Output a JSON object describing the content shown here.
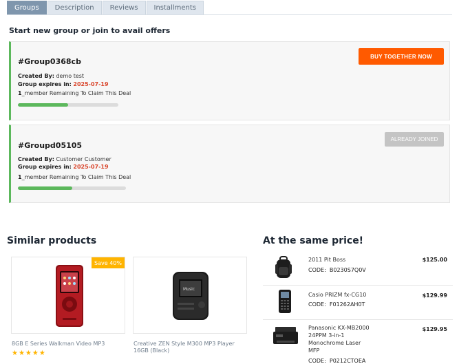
{
  "tabs": [
    {
      "label": "Groups",
      "active": true
    },
    {
      "label": "Description",
      "active": false
    },
    {
      "label": "Reviews",
      "active": false
    },
    {
      "label": "Installments",
      "active": false
    }
  ],
  "groups_section": {
    "title": "Start new group or join to avail offers",
    "groups": [
      {
        "name": "#Group0368cb",
        "created_by_label": "Created By:",
        "created_by": "demo test",
        "expires_label": "Group expires in:",
        "expires": "2025-07-19",
        "remaining_count": "1",
        "remaining_text": "_member Remaining To Claim This Deal",
        "progress": 0.5,
        "action_label": "BUY TOGETHER NOW"
      },
      {
        "name": "#Groupd05105",
        "created_by_label": "Created By:",
        "created_by": "Customer Customer",
        "expires_label": "Group expires in:",
        "expires": "2025-07-19",
        "remaining_count": "1",
        "remaining_text": "_member Remaining To Claim This Deal",
        "progress": 0.5,
        "action_label": "ALREADY JOINED"
      }
    ]
  },
  "similar": {
    "title": "Similar products",
    "products": [
      {
        "name": "8GB E Series Walkman Video MP3",
        "badge": "Save 40%",
        "stars": "★★★★★",
        "image": "red-walkman-icon"
      },
      {
        "name": "Creative ZEN Style M300 MP3 Player 16GB (Black)",
        "badge": "",
        "image": "black-mp3-player-icon"
      }
    ]
  },
  "same_price": {
    "title": "At the same price!",
    "code_label": "CODE:",
    "items": [
      {
        "name": "2011 Pit Boss",
        "code": "B0230S7Q0V",
        "price": "$125.00",
        "image": "backpack-icon"
      },
      {
        "name": "Casio PRIZM fx-CG10",
        "code": "F01262AH0T",
        "price": "$129.99",
        "image": "calculator-icon"
      },
      {
        "name": "Panasonic KX-MB2000 24PPM 3-in-1 Monochrome Laser MFP",
        "code": "P0212CTOEA",
        "price": "$129.95",
        "image": "printer-icon"
      }
    ]
  },
  "colors": {
    "accent": "#ff5a00",
    "success": "#5cb85c",
    "date": "#d9452b",
    "badge": "#ffb400"
  }
}
